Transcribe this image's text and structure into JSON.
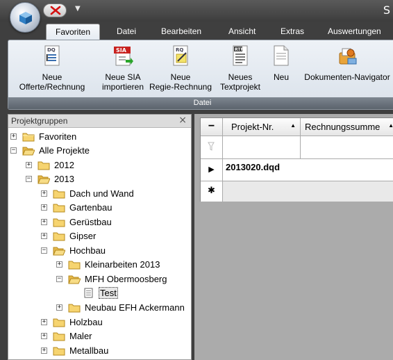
{
  "window": {
    "title_fragment": "S"
  },
  "tabs": [
    "Favoriten",
    "Datei",
    "Bearbeiten",
    "Ansicht",
    "Extras",
    "Auswertungen"
  ],
  "ribbon": {
    "group_label": "Datei",
    "buttons": [
      {
        "line1": "Neue",
        "line2": "Offerte/Rechnung",
        "icon": "dq-document-icon"
      },
      {
        "line1": "Neue SIA",
        "line2": "importieren",
        "icon": "sia-import-icon"
      },
      {
        "line1": "Neue",
        "line2": "Regie-Rechnung",
        "icon": "rq-document-icon"
      },
      {
        "line1": "Neues",
        "line2": "Textprojekt",
        "icon": "rtf-document-icon"
      },
      {
        "line1": "Neu",
        "line2": "",
        "icon": "blank-document-icon"
      },
      {
        "line1": "Dokumenten-Navigator",
        "line2": "",
        "icon": "document-navigator-icon"
      }
    ]
  },
  "left_panel": {
    "title": "Projektgruppen",
    "close": "×",
    "tree": [
      {
        "label": "Favoriten",
        "expander": "+"
      },
      {
        "label": "Alle Projekte",
        "expander": "−"
      },
      {
        "label": "2012",
        "expander": "+"
      },
      {
        "label": "2013",
        "expander": "−"
      },
      {
        "label": "Dach und Wand",
        "expander": "+"
      },
      {
        "label": "Gartenbau",
        "expander": "+"
      },
      {
        "label": "Gerüstbau",
        "expander": "+"
      },
      {
        "label": "Gipser",
        "expander": "+"
      },
      {
        "label": "Hochbau",
        "expander": "−"
      },
      {
        "label": "Kleinarbeiten 2013",
        "expander": "+"
      },
      {
        "label": "MFH Obermoosberg",
        "expander": "−"
      },
      {
        "label": "Test",
        "expander": ""
      },
      {
        "label": "Neubau EFH Ackermann",
        "expander": "+"
      },
      {
        "label": "Holzbau",
        "expander": "+"
      },
      {
        "label": "Maler",
        "expander": "+"
      },
      {
        "label": "Metallbau",
        "expander": "+"
      }
    ]
  },
  "grid": {
    "collapse_glyph": "−",
    "columns": [
      "Projekt-Nr.",
      "Rechnungssumme"
    ],
    "rows": [
      {
        "indicator": "▶",
        "project": "2013020.dqd",
        "sum": ""
      },
      {
        "indicator": "✱",
        "project": "",
        "sum": ""
      }
    ]
  }
}
